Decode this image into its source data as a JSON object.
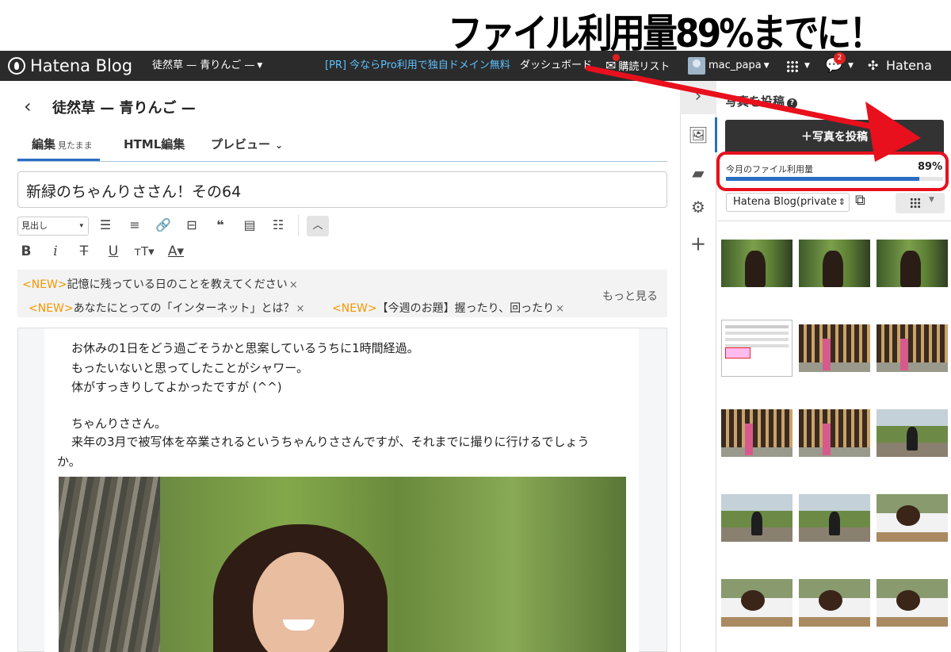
{
  "annotation": {
    "headline": "ファイル利用量89%までに！"
  },
  "navbar": {
    "brand": "Hatena Blog",
    "blog_menu": "徒然草 — 青りんご —",
    "promo": "[PR] 今ならPro利用で独自ドメイン無料",
    "dashboard": "ダッシュボード",
    "reading_list": "購読リスト",
    "username": "mac_papa",
    "notification_count": "2",
    "hatena": "Hatena"
  },
  "editor": {
    "back": "‹",
    "blog_title": "徒然草 — 青りんご —",
    "tabs": {
      "edit": "編集",
      "edit_sub": "見たまま",
      "html": "HTML編集",
      "preview": "プレビュー"
    },
    "title_value": "新緑のちゃんりささん！その64",
    "heading_select": "見出し",
    "topics": [
      {
        "new": "<NEW>",
        "text": "記憶に残っている日のことを教えてください",
        "close": "×"
      },
      {
        "new": "<NEW>",
        "text": "あなたにとっての「インターネット」とは？",
        "close": "×"
      },
      {
        "new": "<NEW>",
        "text": "【今週のお題】握ったり、回ったり",
        "close": "×"
      }
    ],
    "more": "もっと見る",
    "body_lines": [
      "お休みの1日をどう過ごそうかと思案しているうちに1時間経過。",
      "もったいないと思ってしたことがシャワー。",
      "体がすっきりしてよかったですが (^^)",
      "ちゃんりささん。",
      "来年の3月で被写体を卒業されるというちゃんりささんですが、それまでに撮りに行けるでしょう",
      "か。"
    ]
  },
  "panel": {
    "title": "写真を投稿",
    "upload_button": "＋写真を投稿",
    "usage_label": "今月のファイル利用量",
    "usage_percent": "89%",
    "usage_fraction": 0.89,
    "blog_select": "Hatena Blog(private)"
  },
  "colors": {
    "accent": "#2a6ec4",
    "highlight": "#e8101d",
    "new_label": "#f39800",
    "navbar": "#2b2b2b",
    "promo": "#5fc1ff"
  }
}
